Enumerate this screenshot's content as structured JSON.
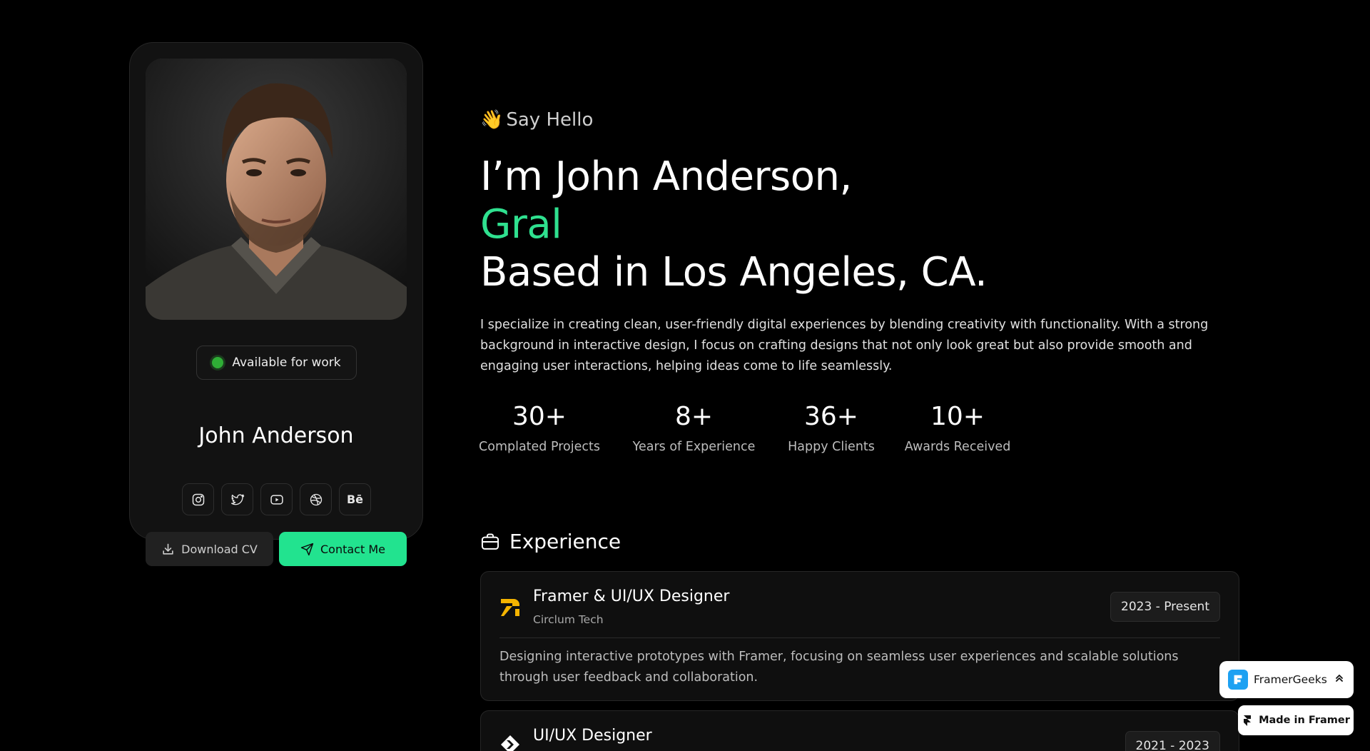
{
  "profile": {
    "status_label": "Available for work",
    "name": "John Anderson",
    "socials": [
      {
        "icon": "instagram-icon"
      },
      {
        "icon": "twitter-icon"
      },
      {
        "icon": "youtube-icon"
      },
      {
        "icon": "dribbble-icon"
      },
      {
        "icon": "behance-icon",
        "text": "Bē"
      }
    ],
    "download_cv_label": "Download CV",
    "contact_label": "Contact Me",
    "status_color": "#2fae36",
    "accent_color": "#22e38f"
  },
  "hero": {
    "greeting_emoji": "👋",
    "greeting": "Say Hello",
    "line1": "I’m John Anderson,",
    "line2": "Gral",
    "line3": "Based in Los Angeles, CA.",
    "bio": "I specialize in creating clean, user-friendly digital experiences by blending creativity with functionality. With a strong background in interactive design, I focus on crafting designs that not only look great but also provide smooth and engaging user interactions, helping ideas come to life seamlessly."
  },
  "stats": [
    {
      "value": "30+",
      "label": "Complated Projects"
    },
    {
      "value": "8+",
      "label": "Years of Experience"
    },
    {
      "value": "36+",
      "label": "Happy Clients"
    },
    {
      "value": "10+",
      "label": "Awards Received"
    }
  ],
  "experience": {
    "heading": "Experience",
    "items": [
      {
        "title": "Framer & UI/UX Designer",
        "company": "Circlum Tech",
        "dates": "2023 - Present",
        "description": "Designing interactive prototypes with Framer, focusing on seamless user experiences and scalable solutions through user feedback and collaboration.",
        "logo_color": "#f5b400"
      },
      {
        "title": "UI/UX Designer",
        "dates": "2021 - 2023"
      }
    ]
  },
  "badges": {
    "framergeeks_label": "FramerGeeks",
    "made_in_framer_label": "Made in Framer"
  }
}
